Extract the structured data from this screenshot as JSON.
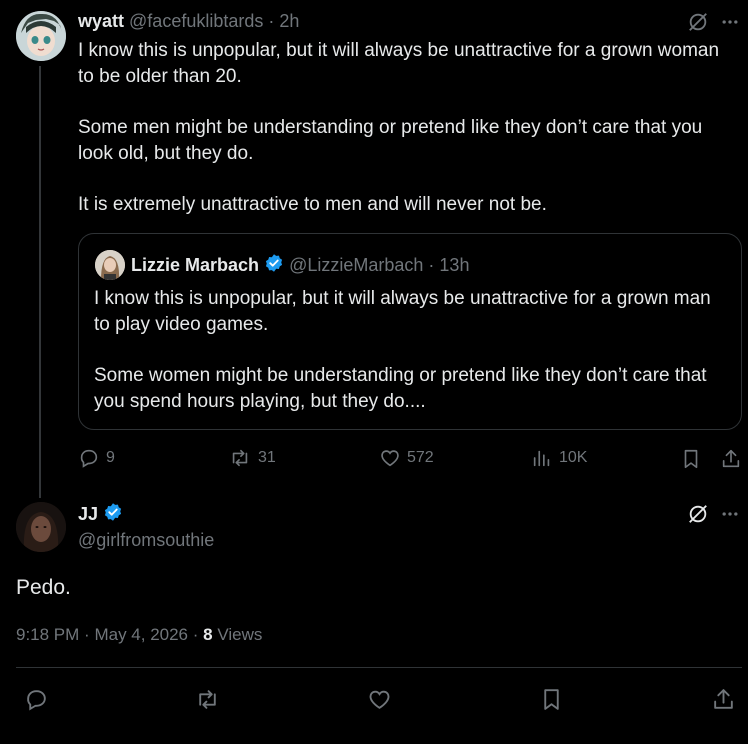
{
  "parent_tweet": {
    "display_name": "wyatt",
    "handle": "@facefuklibtards",
    "time": "2h",
    "separator": "·",
    "paragraphs": [
      "I know this is unpopular, but it will always be unattractive for a grown woman to be older than 20.",
      "Some men might be understanding or pretend like they don’t care that you look old, but they do.",
      "It is extremely unattractive to men and will never not be."
    ],
    "quote": {
      "display_name": "Lizzie Marbach",
      "handle": "@LizzieMarbach",
      "time": "13h",
      "separator": "·",
      "paragraphs": [
        "I know this is unpopular, but it will always be unattractive for a grown man to play video games.",
        "Some women might be understanding or pretend like they don’t care that you spend hours playing, but they do...."
      ]
    },
    "stats": {
      "replies": "9",
      "reposts": "31",
      "likes": "572",
      "views": "10K"
    }
  },
  "main_tweet": {
    "display_name": "JJ",
    "handle": "@girlfromsouthie",
    "text": "Pedo.",
    "time": "9:18 PM",
    "date": "May 4, 2026",
    "separator": "·",
    "views_count": "8",
    "views_label": "Views"
  },
  "icons": {
    "grok": "grok-icon",
    "more": "more-icon",
    "reply": "reply-icon",
    "repost": "repost-icon",
    "like": "like-icon",
    "views": "views-icon",
    "bookmark": "bookmark-icon",
    "share": "share-icon",
    "verified": "verified-badge-icon"
  },
  "colors": {
    "background": "#000000",
    "text": "#e7e9ea",
    "muted": "#71767b",
    "verified": "#1d9bf0",
    "border": "#2f3336"
  }
}
